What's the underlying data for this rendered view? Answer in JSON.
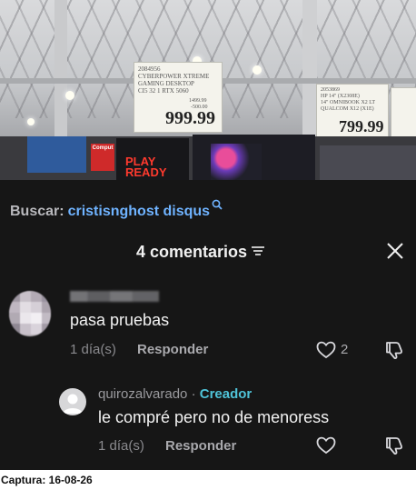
{
  "photo": {
    "sign_left": {
      "sku": "2084956",
      "lines": [
        "CYBERPOWER XTREME",
        "GAMING DESKTOP",
        "CI5 32 1 RTX 5060"
      ],
      "price": "999.99",
      "small_prices": [
        "1499.99",
        "-500.00"
      ]
    },
    "sign_right": {
      "sku": "2053869",
      "lines": [
        "HP 14\" (X2308E)",
        "14\" OMNIBOOK X2 LT",
        "QUALCOM X12 (X1E)"
      ],
      "price": "799.99"
    },
    "box_text": [
      "PLAY",
      "READY"
    ],
    "small_tag": "Comput"
  },
  "search": {
    "label": "Buscar:",
    "query": "cristisnghost disqus"
  },
  "header": {
    "count": "4 comentarios",
    "close": "✕"
  },
  "comments": [
    {
      "username": "",
      "text": "pasa pruebas",
      "time": "1 día(s)",
      "reply": "Responder",
      "likes": "2"
    },
    {
      "username": "quirozalvarado",
      "separator": " · ",
      "badge": "Creador",
      "text": "le compré pero no de menoress",
      "time": "1 día(s)",
      "reply": "Responder"
    }
  ],
  "caption": "Captura: 16-08-26",
  "colors": {
    "panel_bg": "#161616",
    "accent_blue": "#6fb3ff",
    "creator_teal": "#4fc3d8"
  },
  "icons": {
    "search": "search-icon",
    "filter": "filter-icon",
    "close": "close-icon",
    "heart": "heart-icon",
    "dislike": "dislike-icon"
  }
}
